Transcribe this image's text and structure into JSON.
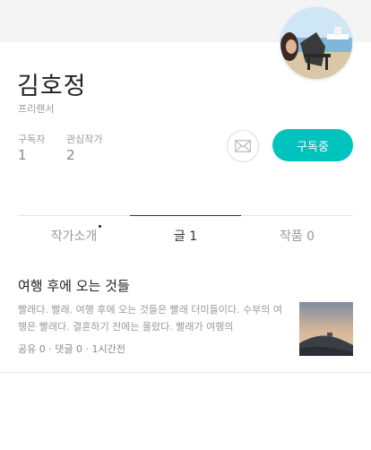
{
  "profile": {
    "name": "김호정",
    "job": "프리랜서",
    "stats": [
      {
        "label": "구독자",
        "value": "1"
      },
      {
        "label": "관심작가",
        "value": "2"
      }
    ],
    "subscribe_label": "구독중",
    "mail_icon": "envelope-icon"
  },
  "tabs": [
    {
      "label": "작가소개",
      "has_new_dot": true,
      "active": false
    },
    {
      "label": "글 1",
      "active": true
    },
    {
      "label": "작품 0",
      "active": false
    }
  ],
  "article": {
    "title": "여행 후에 오는 것들",
    "excerpt": "빨래다. 빨래. 여행 후에 오는 것들은 빨래 더미들이다. 수부의 여행은 빨래다.  결혼하기 전에는 몰랐다. 빨래가 여행의",
    "meta": "공유 0 · 댓글 0 · 1시간전"
  },
  "colors": {
    "accent": "#00c3bd",
    "top_band": "#f4f4f4",
    "muted_text": "#999999"
  }
}
